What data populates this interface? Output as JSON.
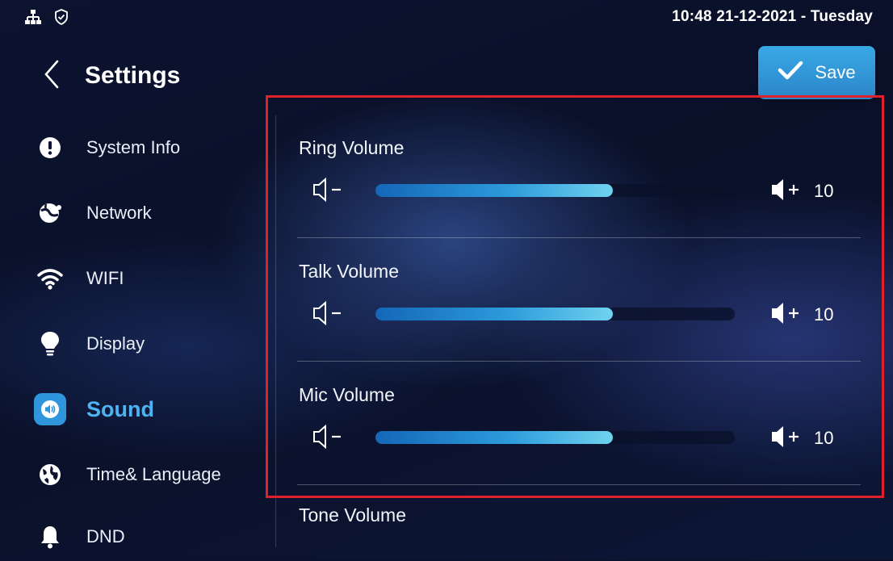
{
  "status_bar": {
    "clock": "10:48  21-12-2021 - Tuesday",
    "icons": [
      "network-tree-icon",
      "shield-check-icon"
    ]
  },
  "header": {
    "title": "Settings",
    "save_label": "Save"
  },
  "sidebar": {
    "items": [
      {
        "label": "System Info",
        "icon": "info-icon",
        "active": false
      },
      {
        "label": "Network",
        "icon": "network-globe-icon",
        "active": false
      },
      {
        "label": "WIFI",
        "icon": "wifi-icon",
        "active": false
      },
      {
        "label": "Display",
        "icon": "lightbulb-icon",
        "active": false
      },
      {
        "label": "Sound",
        "icon": "speaker-icon",
        "active": true
      },
      {
        "label": "Time& Language",
        "icon": "globe-icon",
        "active": false
      },
      {
        "label": "DND",
        "icon": "bell-icon",
        "active": false
      }
    ]
  },
  "sound": {
    "volumes": [
      {
        "label": "Ring Volume",
        "value": "10",
        "level": 0.66
      },
      {
        "label": "Talk Volume",
        "value": "10",
        "level": 0.66
      },
      {
        "label": "Mic Volume",
        "value": "10",
        "level": 0.66
      }
    ],
    "next_label": "Tone Volume"
  },
  "colors": {
    "accent": "#2f95dc",
    "active_text": "#4db3f2",
    "highlight_frame": "#e0202a"
  }
}
